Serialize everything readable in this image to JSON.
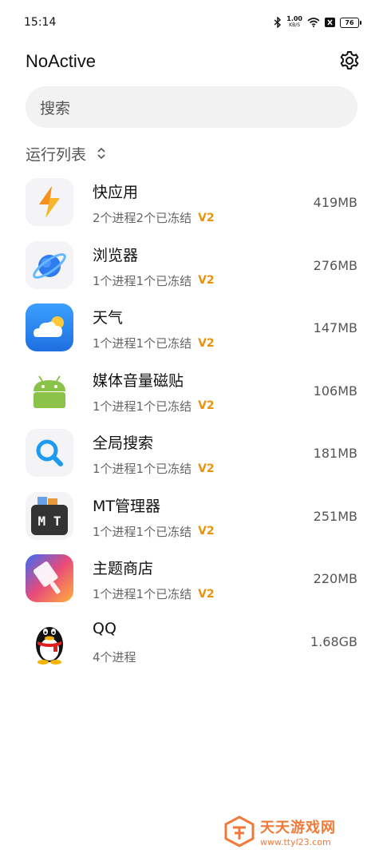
{
  "status_bar": {
    "time": "15:14",
    "net_speed_value": "1.00",
    "net_speed_unit": "KB/S",
    "battery": "76",
    "icons": [
      "bluetooth-icon",
      "wifi-icon",
      "no-sim-icon",
      "battery-icon"
    ]
  },
  "header": {
    "title": "NoActive",
    "settings_icon": "gear-icon"
  },
  "search": {
    "placeholder": "搜索"
  },
  "section": {
    "title": "运行列表",
    "sort_icon": "sort-updown-icon"
  },
  "apps": [
    {
      "name": "快应用",
      "status": "2个进程2个已冻结",
      "badge": "V2",
      "memory": "419MB",
      "icon": "lightning-icon"
    },
    {
      "name": "浏览器",
      "status": "1个进程1个已冻结",
      "badge": "V2",
      "memory": "276MB",
      "icon": "browser-planet-icon"
    },
    {
      "name": "天气",
      "status": "1个进程1个已冻结",
      "badge": "V2",
      "memory": "147MB",
      "icon": "weather-cloud-icon"
    },
    {
      "name": "媒体音量磁贴",
      "status": "1个进程1个已冻结",
      "badge": "V2",
      "memory": "106MB",
      "icon": "android-icon"
    },
    {
      "name": "全局搜索",
      "status": "1个进程1个已冻结",
      "badge": "V2",
      "memory": "181MB",
      "icon": "search-magnifier-icon"
    },
    {
      "name": "MT管理器",
      "status": "1个进程1个已冻结",
      "badge": "V2",
      "memory": "251MB",
      "icon": "mt-manager-icon"
    },
    {
      "name": "主题商店",
      "status": "1个进程1个已冻结",
      "badge": "V2",
      "memory": "220MB",
      "icon": "theme-store-icon"
    },
    {
      "name": "QQ",
      "status": "4个进程",
      "badge": "",
      "memory": "1.68GB",
      "icon": "qq-penguin-icon"
    }
  ],
  "watermark": {
    "title": "天天游戏网",
    "url": "www.ttyl23.com"
  },
  "colors": {
    "badge": "#e8920f",
    "search_bg": "#f2f2f2",
    "watermark": "#f07a3a"
  }
}
